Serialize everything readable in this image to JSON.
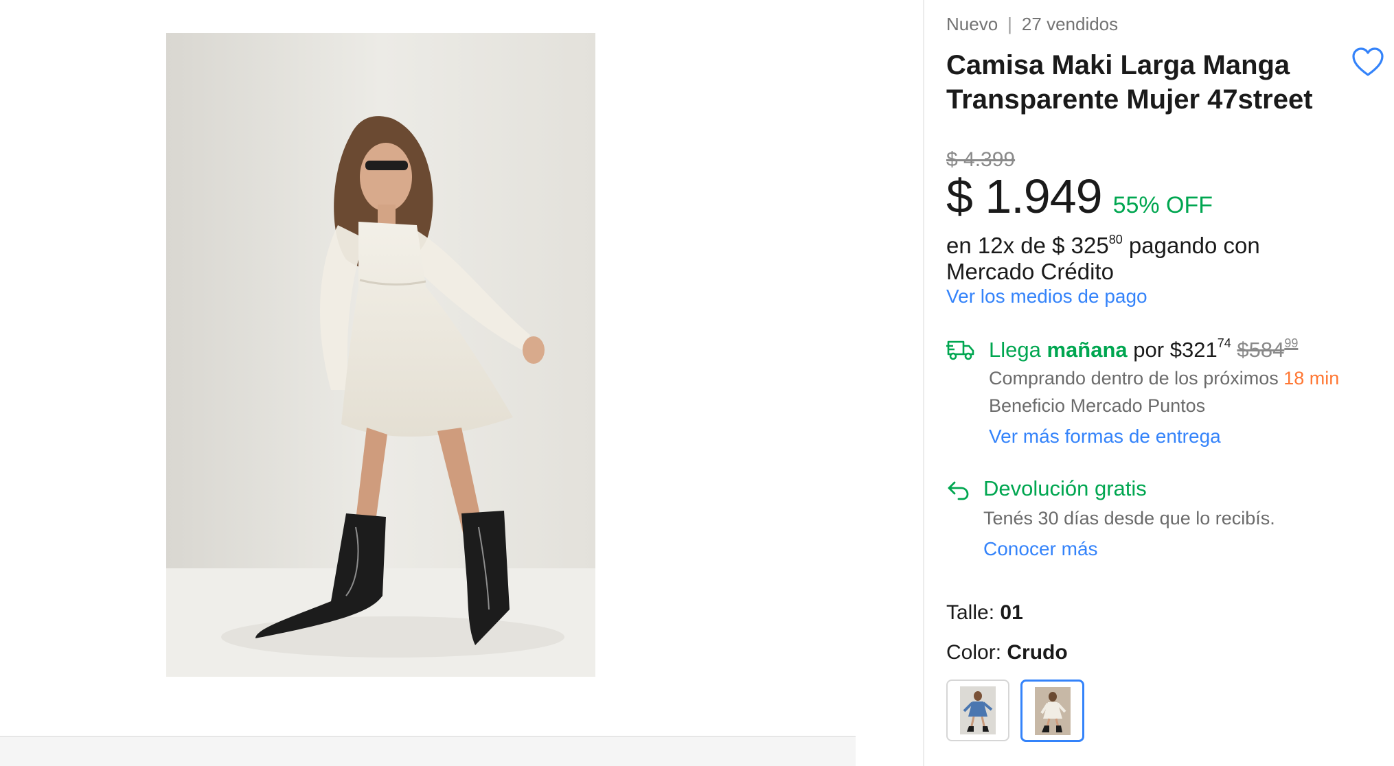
{
  "product": {
    "condition": "Nuevo",
    "separator": "|",
    "sold": "27 vendidos",
    "title": "Camisa Maki Larga Manga Transparente Mujer 47street",
    "favorite_icon": "heart-outline-icon"
  },
  "pricing": {
    "original_price": "$ 4.399",
    "price": "$ 1.949",
    "discount": "55% OFF",
    "installments_prefix": "en 12x de $ 325",
    "installments_cents": "80",
    "installments_suffix": "pagando con Mercado Crédito",
    "payment_link": "Ver los medios de pago"
  },
  "shipping": {
    "icon": "truck-icon",
    "llega": "Llega",
    "manana": "mañana",
    "por": "por",
    "currency": "$",
    "price_int": "321",
    "price_cents": "74",
    "old_price_int": "$584",
    "old_price_cents": "99",
    "countdown_prefix": "Comprando dentro de los próximos",
    "countdown_value": "18 min",
    "benefit": "Beneficio Mercado Puntos",
    "more_link": "Ver más formas de entrega"
  },
  "returns": {
    "icon": "return-arrow-icon",
    "title": "Devolución gratis",
    "description": "Tenés 30 días desde que lo recibís.",
    "link": "Conocer más"
  },
  "variations": {
    "size_label": "Talle:",
    "size_value": "01",
    "color_label": "Color:",
    "color_value": "Crudo",
    "swatch_count": 2,
    "selected_swatch": 2
  },
  "colors": {
    "accent_blue": "#3483fa",
    "discount_green": "#00a650",
    "countdown_orange": "#ff7733"
  }
}
